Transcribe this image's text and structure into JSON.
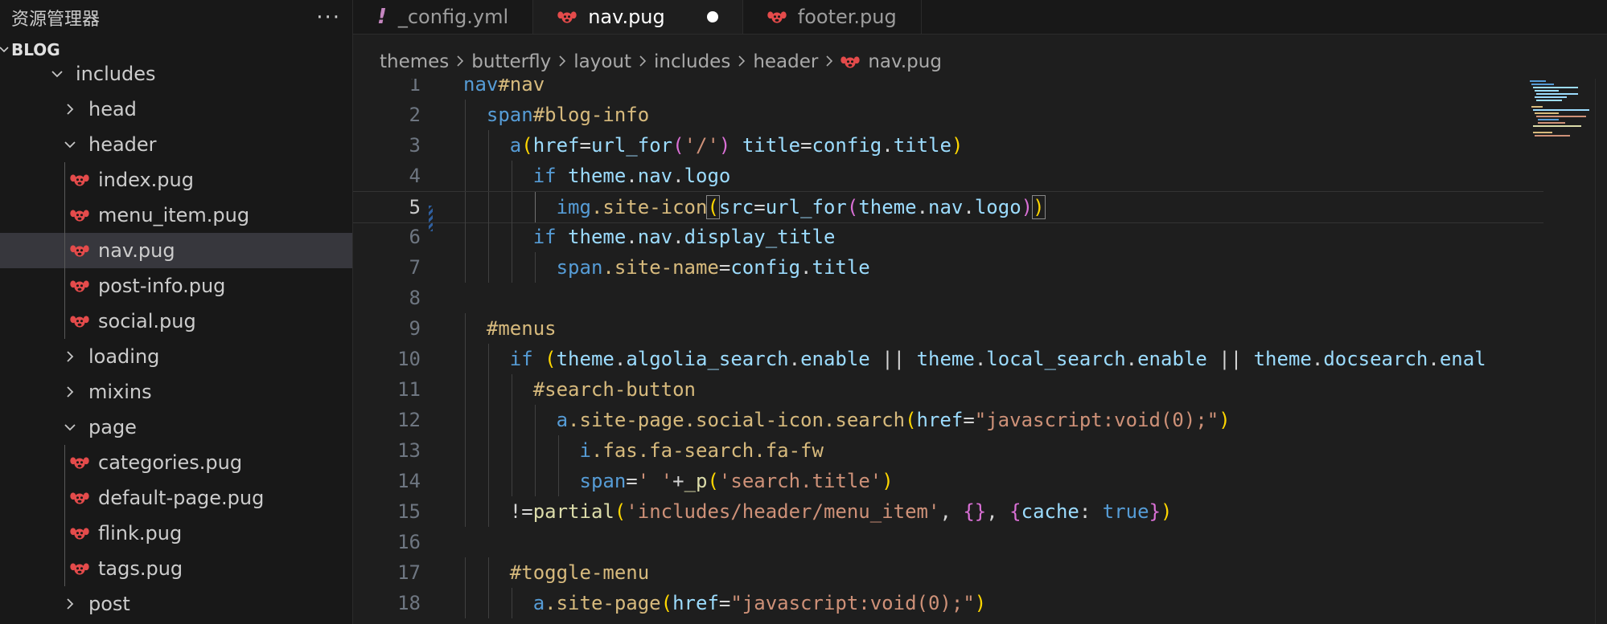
{
  "sidebar": {
    "title": "资源管理器",
    "more_label": "···",
    "section": "BLOG",
    "items": [
      {
        "label": "includes",
        "type": "folder-open"
      },
      {
        "label": "head",
        "type": "folder"
      },
      {
        "label": "header",
        "type": "folder-open"
      },
      {
        "label": "index.pug",
        "type": "file"
      },
      {
        "label": "menu_item.pug",
        "type": "file"
      },
      {
        "label": "nav.pug",
        "type": "file",
        "active": true
      },
      {
        "label": "post-info.pug",
        "type": "file"
      },
      {
        "label": "social.pug",
        "type": "file"
      },
      {
        "label": "loading",
        "type": "folder"
      },
      {
        "label": "mixins",
        "type": "folder"
      },
      {
        "label": "page",
        "type": "folder-open"
      },
      {
        "label": "categories.pug",
        "type": "file"
      },
      {
        "label": "default-page.pug",
        "type": "file"
      },
      {
        "label": "flink.pug",
        "type": "file"
      },
      {
        "label": "tags.pug",
        "type": "file"
      },
      {
        "label": "post",
        "type": "folder"
      }
    ]
  },
  "tabs": [
    {
      "label": "_config.yml",
      "icon": "exclamation-icon"
    },
    {
      "label": "nav.pug",
      "icon": "pug-icon",
      "active": true,
      "modified": true
    },
    {
      "label": "footer.pug",
      "icon": "pug-icon"
    }
  ],
  "breadcrumb": [
    "themes",
    "butterfly",
    "layout",
    "includes",
    "header",
    "nav.pug"
  ],
  "editor": {
    "current_line": 5,
    "line_numbers": [
      "1",
      "2",
      "3",
      "4",
      "5",
      "6",
      "7",
      "8",
      "9",
      "10",
      "11",
      "12",
      "13",
      "14",
      "15",
      "16",
      "17",
      "18"
    ]
  },
  "colors": {
    "background": "#1e1e1e",
    "sidebar": "#181818",
    "active_row": "#37373d",
    "pug_icon": "#e44b4b"
  }
}
